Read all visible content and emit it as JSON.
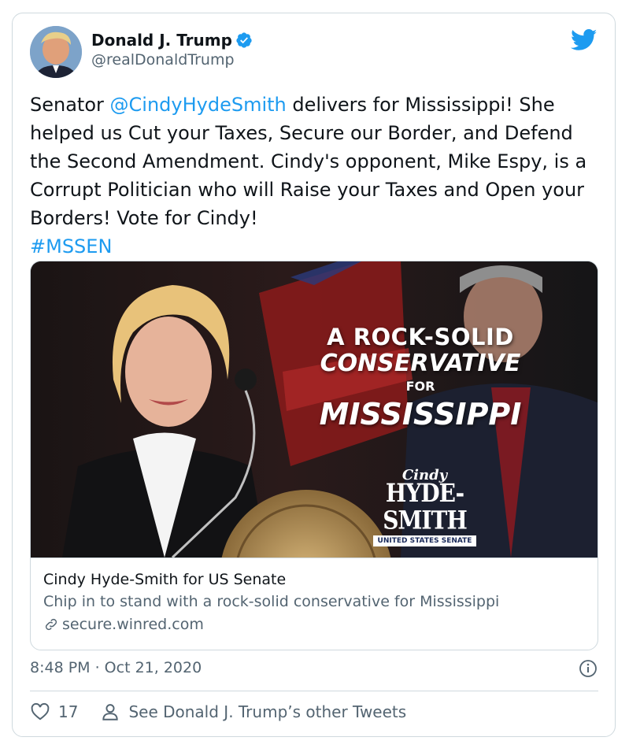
{
  "author": {
    "name": "Donald J. Trump",
    "handle": "@realDonaldTrump"
  },
  "tweet": {
    "text_before_mention": "Senator ",
    "mention": "@CindyHydeSmith",
    "text_after_mention": " delivers for Mississippi! She helped us Cut your Taxes, Secure our Border, and Defend the Second Amendment. Cindy's opponent, Mike Espy, is a Corrupt Politician who will Raise your Taxes and Open your Borders! Vote for Cindy!\n",
    "hashtag": "#MSSEN"
  },
  "media": {
    "headline_line1": "A ROCK-SOLID",
    "headline_line2": "CONSERVATIVE",
    "headline_line3": "FOR",
    "headline_line4": "MISSISSIPPI",
    "logo_first": "Cindy",
    "logo_last": "HYDE-SMITH",
    "logo_sub": "UNITED STATES SENATE"
  },
  "link_card": {
    "title": "Cindy Hyde-Smith for US Senate",
    "description": "Chip in to stand with a rock-solid conservative for Mississippi",
    "domain": "secure.winred.com"
  },
  "timestamp": "8:48 PM · Oct 21, 2020",
  "actions": {
    "like_count": "17",
    "see_more_label": "See Donald J. Trump’s other Tweets"
  },
  "colors": {
    "accent": "#1d9bf0",
    "secondary_text": "#536471",
    "border": "#cfd9de"
  },
  "icons": [
    "verified-badge-icon",
    "twitter-bird-icon",
    "link-icon",
    "info-icon",
    "heart-icon",
    "person-icon"
  ]
}
